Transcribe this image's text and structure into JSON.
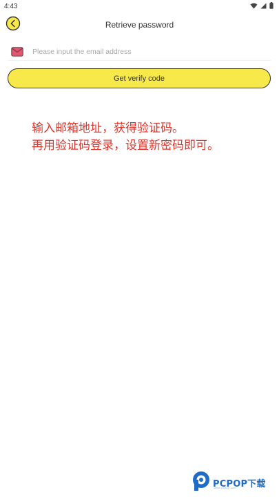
{
  "status_bar": {
    "time": "4:43",
    "icons": [
      "wifi-icon",
      "signal-icon",
      "battery-icon"
    ]
  },
  "header": {
    "title": "Retrieve password",
    "back_icon": "chevron-left-circle-icon"
  },
  "email": {
    "icon": "mail-icon",
    "value": "",
    "placeholder": "Please input the email address"
  },
  "verify_button": {
    "label": "Get verify code"
  },
  "instruction": {
    "line1": "输入邮箱地址，获得验证码。",
    "line2": "再用验证码登录，设置新密码即可。"
  },
  "watermark": {
    "text": "PCPOP下载",
    "subtext": "www.pcpop.com"
  },
  "colors": {
    "accent_yellow": "#f8e94b",
    "mail_icon_pink": "#e2566e",
    "instruction_red": "#e0352b",
    "watermark_blue": "#1e6cc7"
  }
}
